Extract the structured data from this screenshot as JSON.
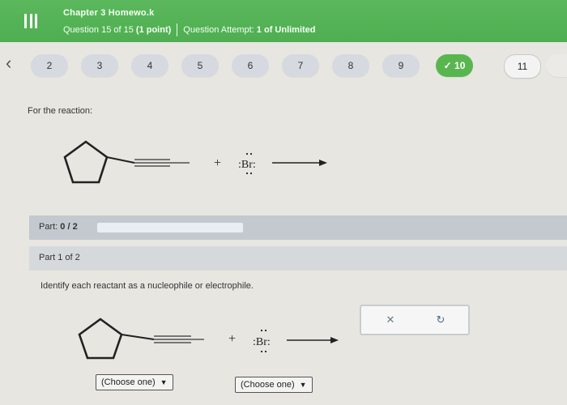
{
  "header": {
    "title": "Chapter 3 Homewo.k",
    "question_progress": "Question 15 of 15",
    "points": "(1 point)",
    "attempt_label": "Question Attempt:",
    "attempt_value": "1 of Unlimited"
  },
  "nav": {
    "questions": [
      {
        "label": "2",
        "state": "default"
      },
      {
        "label": "3",
        "state": "default"
      },
      {
        "label": "4",
        "state": "default"
      },
      {
        "label": "5",
        "state": "default"
      },
      {
        "label": "6",
        "state": "default"
      },
      {
        "label": "7",
        "state": "default"
      },
      {
        "label": "8",
        "state": "default"
      },
      {
        "label": "9",
        "state": "default"
      },
      {
        "label": "✓ 10",
        "state": "done"
      },
      {
        "label": "11",
        "state": "current"
      }
    ]
  },
  "content": {
    "reaction_label": "For the reaction:",
    "reagent": ":Br:",
    "plus": "+",
    "part_label": "Part:",
    "part_value": "0 / 2",
    "part_progress": 0,
    "part_of": "Part 1 of 2",
    "instruction": "Identify each reactant as a nucleophile or electrophile.",
    "dropdown_1": "(Choose one)",
    "dropdown_2": "(Choose one)",
    "clear_symbol": "✕",
    "reset_symbol": "↻"
  },
  "colors": {
    "header_green": "#4fae51",
    "done_green": "#59b64f",
    "part_bar": "#c3c9cf"
  }
}
